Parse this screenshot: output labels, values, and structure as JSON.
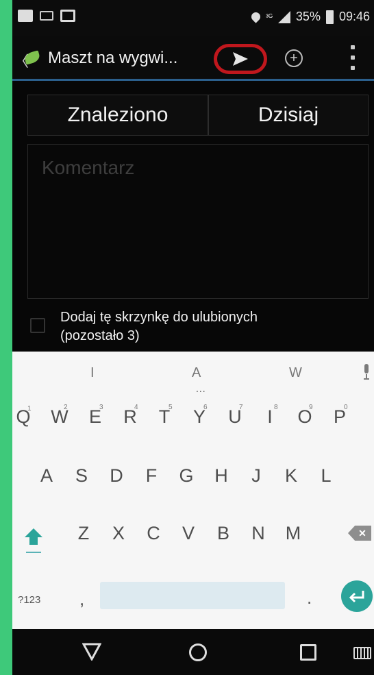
{
  "status_bar": {
    "signal": "³ᴳ",
    "battery": "35%",
    "time": "09:46"
  },
  "action_bar": {
    "back_glyph": "〈",
    "title": "Maszt na wygwi..."
  },
  "form": {
    "found_label": "Znaleziono",
    "date_label": "Dzisiaj",
    "comment_placeholder": "Komentarz",
    "favorite_label_line1": "Dodaj tę skrzynkę do ulubionych",
    "favorite_label_line2": "(pozostało 3)"
  },
  "keyboard": {
    "suggestions": [
      "I",
      "A",
      "W"
    ],
    "suggestion_dots": "...",
    "row1": [
      "Q",
      "W",
      "E",
      "R",
      "T",
      "Y",
      "U",
      "I",
      "O",
      "P"
    ],
    "row1_hints": [
      "1",
      "2",
      "3",
      "4",
      "5",
      "6",
      "7",
      "8",
      "9",
      "0"
    ],
    "row2": [
      "A",
      "S",
      "D",
      "F",
      "G",
      "H",
      "J",
      "K",
      "L"
    ],
    "row3": [
      "Z",
      "X",
      "C",
      "V",
      "B",
      "N",
      "M"
    ],
    "symbols_label": "?123",
    "comma": ",",
    "period": ".",
    "backspace_glyph": "✕"
  },
  "icons": {
    "accent": "#2ba49a",
    "highlight_ring": "#c0171d",
    "actionbar_underline": "#2b5f8c"
  }
}
